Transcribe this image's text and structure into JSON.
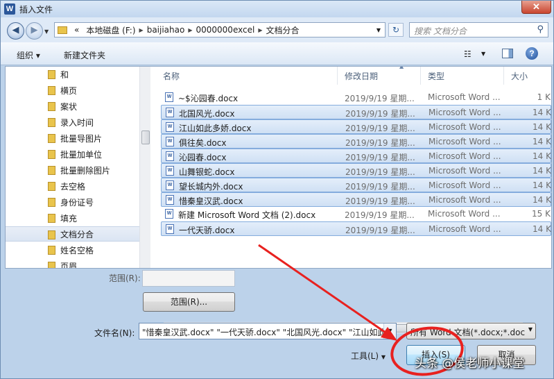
{
  "window": {
    "title": "插入文件",
    "app_icon": "W",
    "close_icon": "close-icon"
  },
  "nav": {
    "address_segments": [
      "«",
      "本地磁盘 (F:)",
      "baijiahao",
      "0000000excel",
      "文档分合"
    ],
    "search_placeholder": "搜索 文档分合"
  },
  "toolbar": {
    "organize": "组织 ▾",
    "new_folder": "新建文件夹"
  },
  "sidebar": {
    "items": [
      "和",
      "横页",
      "案状",
      "录入时间",
      "批量导图片",
      "批量加单位",
      "批量删除图片",
      "去空格",
      "身份证号",
      "填充",
      "文档分合",
      "姓名空格",
      "页眉"
    ],
    "selected": "文档分合"
  },
  "columns": {
    "name": "名称",
    "date": "修改日期",
    "type": "类型",
    "size": "大小"
  },
  "files": [
    {
      "name": "~$沁园春.docx",
      "date": "2019/9/19 星期...",
      "type": "Microsoft Word ...",
      "size": "1 K",
      "selected": false
    },
    {
      "name": "北国风光.docx",
      "date": "2019/9/19 星期...",
      "type": "Microsoft Word ...",
      "size": "14 K",
      "selected": true
    },
    {
      "name": "江山如此多娇.docx",
      "date": "2019/9/19 星期...",
      "type": "Microsoft Word ...",
      "size": "14 K",
      "selected": true
    },
    {
      "name": "俱往矣.docx",
      "date": "2019/9/19 星期...",
      "type": "Microsoft Word ...",
      "size": "14 K",
      "selected": true
    },
    {
      "name": "沁园春.docx",
      "date": "2019/9/19 星期...",
      "type": "Microsoft Word ...",
      "size": "14 K",
      "selected": true
    },
    {
      "name": "山舞银蛇.docx",
      "date": "2019/9/19 星期...",
      "type": "Microsoft Word ...",
      "size": "14 K",
      "selected": true
    },
    {
      "name": "望长城内外.docx",
      "date": "2019/9/19 星期...",
      "type": "Microsoft Word ...",
      "size": "14 K",
      "selected": true
    },
    {
      "name": "惜秦皇汉武.docx",
      "date": "2019/9/19 星期...",
      "type": "Microsoft Word ...",
      "size": "14 K",
      "selected": true
    },
    {
      "name": "新建 Microsoft Word 文档 (2).docx",
      "date": "2019/9/19 星期...",
      "type": "Microsoft Word ...",
      "size": "15 K",
      "selected": false
    },
    {
      "name": "一代天骄.docx",
      "date": "2019/9/19 星期...",
      "type": "Microsoft Word ...",
      "size": "14 K",
      "selected": true
    }
  ],
  "range": {
    "label": "范围(R):",
    "button": "范围(R)..."
  },
  "filename": {
    "label": "文件名(N):",
    "value": "\"惜秦皇汉武.docx\" \"一代天骄.docx\" \"北国风光.docx\" \"江山如此多"
  },
  "filetype": {
    "value": "所有 Word 文档(*.docx;*.doc"
  },
  "buttons": {
    "tools": "工具(L)",
    "insert": "插入(S)",
    "cancel": "取消"
  },
  "watermark": "头条 @侯老师小课堂",
  "colors": {
    "annotation": "#e8211f",
    "selection": "#cfe0f4"
  }
}
